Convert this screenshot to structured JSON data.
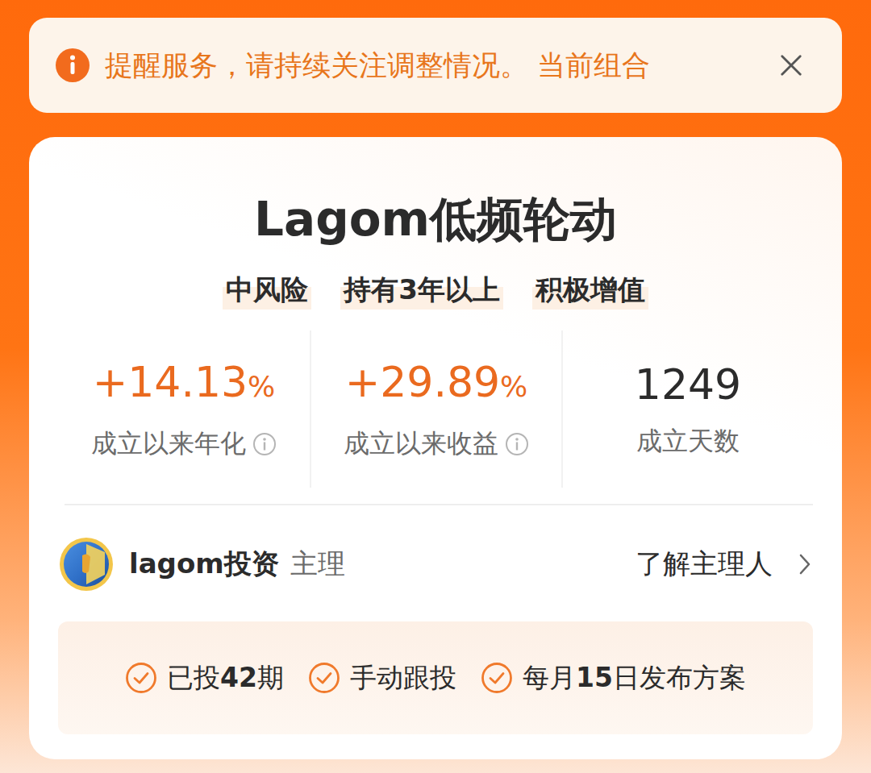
{
  "notice": {
    "text": "提醒服务，请持续关注调整情况。 当前组合"
  },
  "portfolio": {
    "title": "Lagom低频轮动",
    "tags": [
      "中风险",
      "持有3年以上",
      "积极增值"
    ],
    "stats": [
      {
        "value": "+14.13",
        "unit": "%",
        "label": "成立以来年化",
        "info": true,
        "highlight": true
      },
      {
        "value": "+29.89",
        "unit": "%",
        "label": "成立以来收益",
        "info": true,
        "highlight": true
      },
      {
        "value": "1249",
        "label": "成立天数",
        "info": false,
        "highlight": false
      }
    ]
  },
  "manager": {
    "name": "lagom投资",
    "role": "主理",
    "link": "了解主理人"
  },
  "features": [
    {
      "parts": [
        {
          "text": "已投",
          "bold": false
        },
        {
          "text": "42",
          "bold": true
        },
        {
          "text": "期",
          "bold": false
        }
      ]
    },
    {
      "parts": [
        {
          "text": "手动跟投",
          "bold": false
        }
      ]
    },
    {
      "parts": [
        {
          "text": "每月",
          "bold": false
        },
        {
          "text": "15",
          "bold": true
        },
        {
          "text": "日发布方案",
          "bold": false
        }
      ]
    }
  ]
}
